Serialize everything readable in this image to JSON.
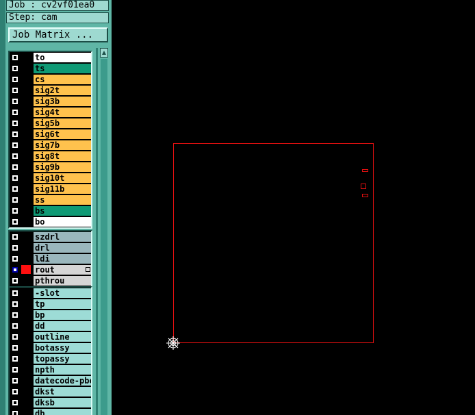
{
  "job": {
    "label": "Job : cv2vf01ea0"
  },
  "step": {
    "label": "Step: cam"
  },
  "job_matrix_button": {
    "label": "Job Matrix ..."
  },
  "colors": {
    "board": "#6ee0d8",
    "signal": "#ffc24d",
    "solder_mask": "#0f9a75",
    "silk": "#ffffff",
    "drill": "#9ab7bd",
    "rout": "#d6d6d6",
    "document": "#9ddcd6",
    "profile_outline": "#e01010"
  },
  "groups": [
    {
      "name": "board-layers",
      "layers": [
        {
          "name": "to",
          "color": "#ffffff",
          "active": false,
          "displayed": false
        },
        {
          "name": "ts",
          "color": "#0f9a75",
          "active": false,
          "displayed": false
        },
        {
          "name": "cs",
          "color": "#ffc24d",
          "active": false,
          "displayed": false
        },
        {
          "name": "sig2t",
          "color": "#ffc24d",
          "active": false,
          "displayed": false
        },
        {
          "name": "sig3b",
          "color": "#ffc24d",
          "active": false,
          "displayed": false
        },
        {
          "name": "sig4t",
          "color": "#ffc24d",
          "active": false,
          "displayed": false
        },
        {
          "name": "sig5b",
          "color": "#ffc24d",
          "active": false,
          "displayed": false
        },
        {
          "name": "sig6t",
          "color": "#ffc24d",
          "active": false,
          "displayed": false
        },
        {
          "name": "sig7b",
          "color": "#ffc24d",
          "active": false,
          "displayed": false
        },
        {
          "name": "sig8t",
          "color": "#ffc24d",
          "active": false,
          "displayed": false
        },
        {
          "name": "sig9b",
          "color": "#ffc24d",
          "active": false,
          "displayed": false
        },
        {
          "name": "sig10t",
          "color": "#ffc24d",
          "active": false,
          "displayed": false
        },
        {
          "name": "sig11b",
          "color": "#ffc24d",
          "active": false,
          "displayed": false
        },
        {
          "name": "ss",
          "color": "#ffc24d",
          "active": false,
          "displayed": false
        },
        {
          "name": "bs",
          "color": "#0f9a75",
          "active": false,
          "displayed": false
        },
        {
          "name": "bo",
          "color": "#ffffff",
          "active": false,
          "displayed": false
        }
      ]
    },
    {
      "name": "drill-layers",
      "layers": [
        {
          "name": "szdrl",
          "color": "#9ab7bd",
          "active": false,
          "displayed": false
        },
        {
          "name": "drl",
          "color": "#9ab7bd",
          "active": false,
          "displayed": false
        },
        {
          "name": "ldi",
          "color": "#9ab7bd",
          "active": false,
          "displayed": false
        },
        {
          "name": "rout",
          "color": "#d6d6d6",
          "active": true,
          "displayed": true,
          "expandable": true
        },
        {
          "name": "pthrou",
          "color": "#d6d6d6",
          "active": false,
          "displayed": false
        }
      ]
    },
    {
      "name": "document-layers",
      "layers": [
        {
          "name": "-slot",
          "color": "#9ddcd6",
          "active": false,
          "displayed": false
        },
        {
          "name": "tp",
          "color": "#9ddcd6",
          "active": false,
          "displayed": false
        },
        {
          "name": "bp",
          "color": "#9ddcd6",
          "active": false,
          "displayed": false
        },
        {
          "name": "dd",
          "color": "#9ddcd6",
          "active": false,
          "displayed": false
        },
        {
          "name": "outline",
          "color": "#9ddcd6",
          "active": false,
          "displayed": false
        },
        {
          "name": "botassy",
          "color": "#9ddcd6",
          "active": false,
          "displayed": false
        },
        {
          "name": "topassy",
          "color": "#9ddcd6",
          "active": false,
          "displayed": false
        },
        {
          "name": "npth",
          "color": "#9ddcd6",
          "active": false,
          "displayed": false
        },
        {
          "name": "datecode-pbe",
          "color": "#9ddcd6",
          "active": false,
          "displayed": false
        },
        {
          "name": "dkst",
          "color": "#9ddcd6",
          "active": false,
          "displayed": false
        },
        {
          "name": "dksb",
          "color": "#9ddcd6",
          "active": false,
          "displayed": false
        },
        {
          "name": "db",
          "color": "#9ddcd6",
          "active": false,
          "displayed": false
        }
      ]
    }
  ],
  "icons": {
    "origin": "origin-crosshair-icon",
    "scroll_up": "arrow-up-icon",
    "expand": "expand-icon"
  }
}
